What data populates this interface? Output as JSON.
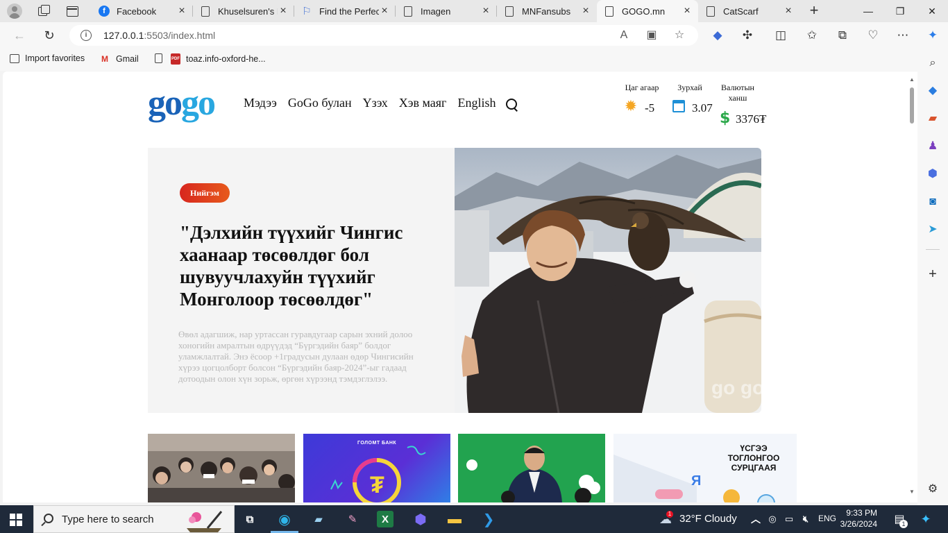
{
  "browser": {
    "tabs": [
      {
        "title": "Facebook",
        "favicon": "facebook-icon"
      },
      {
        "title": "Khuselsuren's P",
        "favicon": "document-icon"
      },
      {
        "title": "Find the Perfect",
        "favicon": "flag-icon"
      },
      {
        "title": "Imagen",
        "favicon": "document-icon"
      },
      {
        "title": "MNFansubs",
        "favicon": "document-icon"
      },
      {
        "title": "GOGO.mn",
        "favicon": "document-icon"
      },
      {
        "title": "CatScarf",
        "favicon": "document-icon"
      }
    ],
    "active_tab": "GOGO.mn",
    "url_host": "127.0.0.1",
    "url_rest": ":5503/index.html",
    "favorites": [
      {
        "label": "Import favorites"
      },
      {
        "label": "Gmail"
      },
      {
        "label": "toaz.info-oxford-he..."
      }
    ]
  },
  "site": {
    "logo_part1": "go",
    "logo_part2": "go",
    "menu": [
      "Мэдээ",
      "GoGo булан",
      "Үзэх",
      "Хэв маяг",
      "English"
    ],
    "widgets": {
      "weather_label": "Цаг агаар",
      "weather_value": "-5",
      "calendar_label": "Зурхай",
      "calendar_value": "3.07",
      "currency_label": "Валютын ханш",
      "currency_value": "3376₮"
    },
    "hero": {
      "badge": "Нийгэм",
      "title": "\"Дэлхийн түүхийг Чингис хаанаар төсөөлдөг бол шувуучлахуйн түүхийг Монголоор төсөөлдөг\"",
      "description": "Өвөл адагшиж, нар уртассан гуравдугаар сарын эхний долоо хоногийн амралтын өдрүүдэд “Бүргэдийн баяр” болдог уламжлалтай. Энэ ёсоор +1градусын дулаан өдөр Чингисийн хүрээ цогцолборт болсон “Бүргэдийн баяр-2024”-ыг гадаад дотоодын олон хүн зорьж, өргөн хүрээнд тэмдэглэлээ.",
      "image_watermark": "go go"
    },
    "thumbnails": [
      {
        "name": "conference-audience"
      },
      {
        "name": "golomt-bank-promo",
        "text": "ГОЛОМТ БАНК"
      },
      {
        "name": "green-stage-event"
      },
      {
        "name": "game-promo",
        "text": "ҮСГЭЭ ТОГЛОНГОО СУРЦГААЯ"
      }
    ]
  },
  "taskbar": {
    "search_placeholder": "Type here to search",
    "weather": "32°F  Cloudy",
    "weather_badge": "1",
    "language": "ENG",
    "time": "9:33 PM",
    "date": "3/26/2024",
    "notification_count": "1"
  },
  "colors": {
    "logo_dark": "#1a63b8",
    "logo_light": "#29a7e0",
    "badge": "#d7261e",
    "taskbar": "#1f2a3a"
  }
}
